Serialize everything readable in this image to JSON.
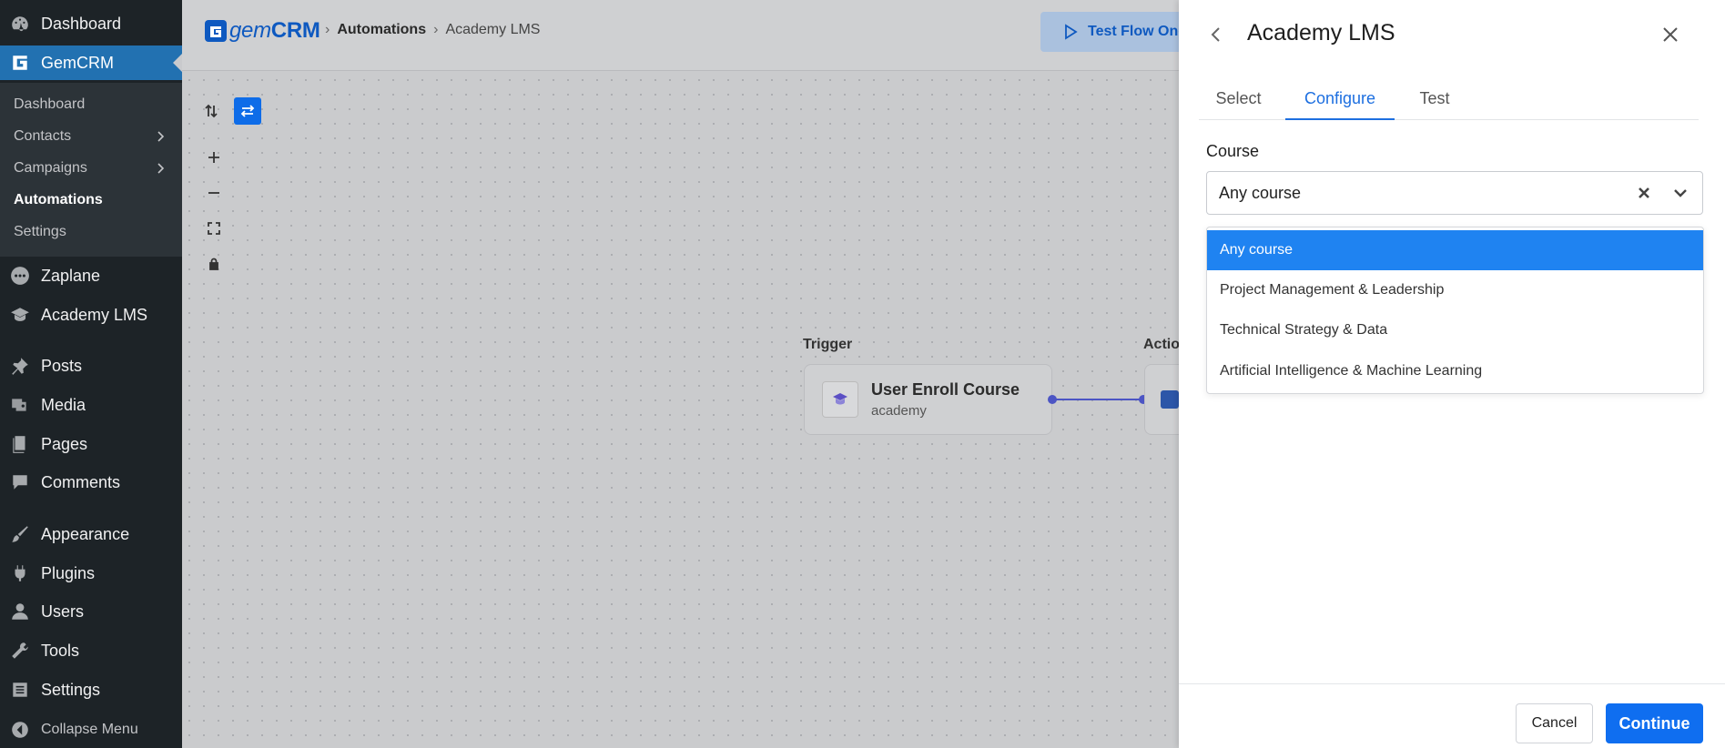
{
  "sidebar": {
    "top_items": [
      {
        "label": "Dashboard",
        "icon": "dashboard-icon"
      },
      {
        "label": "GemCRM",
        "icon": "gemcrm-icon"
      }
    ],
    "submenu": [
      {
        "label": "Dashboard"
      },
      {
        "label": "Contacts",
        "has_children": true
      },
      {
        "label": "Campaigns",
        "has_children": true
      },
      {
        "label": "Automations",
        "current": true
      },
      {
        "label": "Settings"
      }
    ],
    "items": [
      {
        "label": "Zaplane",
        "icon": "zaplane-icon"
      },
      {
        "label": "Academy LMS",
        "icon": "graduation-cap-icon"
      },
      {
        "label": "Posts",
        "icon": "pin-icon"
      },
      {
        "label": "Media",
        "icon": "media-icon"
      },
      {
        "label": "Pages",
        "icon": "pages-icon"
      },
      {
        "label": "Comments",
        "icon": "comment-icon"
      },
      {
        "label": "Appearance",
        "icon": "brush-icon"
      },
      {
        "label": "Plugins",
        "icon": "plugin-icon"
      },
      {
        "label": "Users",
        "icon": "user-icon"
      },
      {
        "label": "Tools",
        "icon": "wrench-icon"
      },
      {
        "label": "Settings",
        "icon": "settings-icon"
      }
    ],
    "collapse_label": "Collapse Menu"
  },
  "header": {
    "logo_prefix": "gem",
    "logo_suffix": "CRM",
    "breadcrumb": [
      "Automations",
      "Academy LMS"
    ],
    "test_flow_label": "Test Flow Once"
  },
  "canvas": {
    "trigger_label": "Trigger",
    "action_label": "Action",
    "trigger_node": {
      "title": "User Enroll Course",
      "subtitle": "academy"
    }
  },
  "panel": {
    "title": "Academy LMS",
    "tabs": [
      {
        "label": "Select"
      },
      {
        "label": "Configure",
        "active": true
      },
      {
        "label": "Test"
      }
    ],
    "course_label": "Course",
    "course_value": "Any course",
    "course_options": [
      {
        "label": "Any course",
        "selected": true
      },
      {
        "label": "Project Management & Leadership"
      },
      {
        "label": "Technical Strategy & Data"
      },
      {
        "label": "Artificial Intelligence & Machine Learning"
      }
    ],
    "cancel_label": "Cancel",
    "continue_label": "Continue"
  },
  "colors": {
    "wp_sidebar": "#1d2327",
    "wp_active": "#2271b1",
    "accent": "#0f6ef0",
    "selected_option": "#1f83f1",
    "connector": "#4c55c4"
  }
}
